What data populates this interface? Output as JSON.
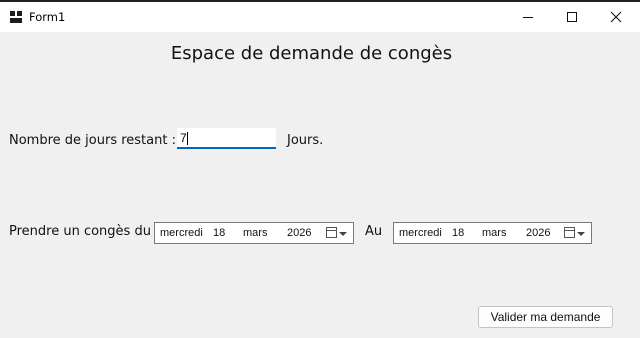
{
  "window": {
    "title": "Form1"
  },
  "form": {
    "heading": "Espace de demande de congès",
    "days_label": "Nombre de jours restant :",
    "days_value": "7",
    "days_suffix": "Jours.",
    "leave_label": "Prendre un congès du",
    "to_label": "Au",
    "start_date": {
      "weekday": "mercredi",
      "day": "18",
      "month": "mars",
      "year": "2026"
    },
    "end_date": {
      "weekday": "mercredi",
      "day": "18",
      "month": "mars",
      "year": "2026"
    },
    "submit_label": "Valider ma demande"
  },
  "colors": {
    "accent": "#0067c0",
    "background": "#f0f0f0"
  }
}
